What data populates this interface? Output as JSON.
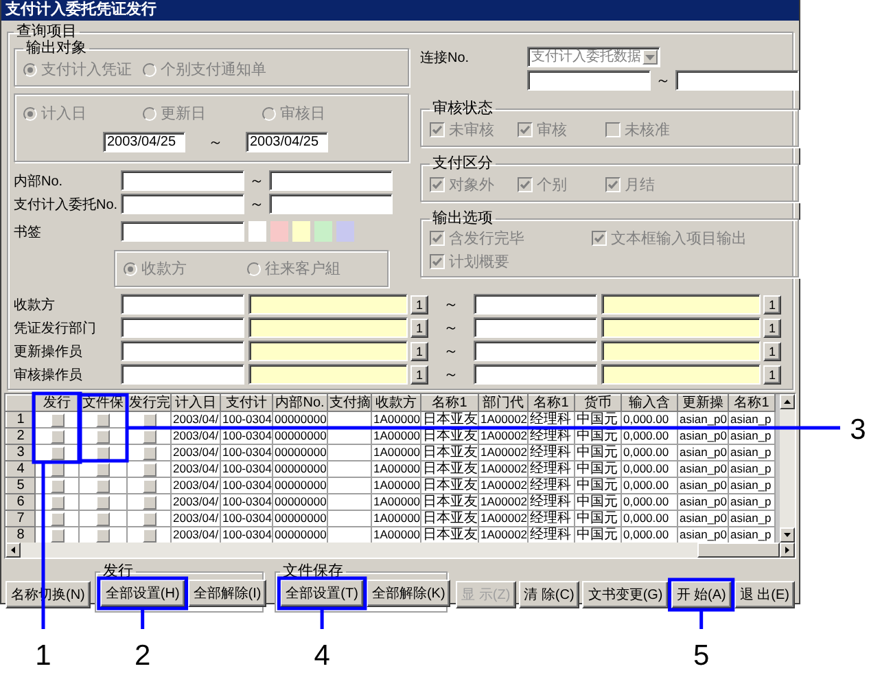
{
  "window": {
    "title": "支付计入委托凭证发行"
  },
  "query": {
    "title": "查询项目",
    "output_target": {
      "title": "输出对象",
      "options": [
        {
          "label": "支付计入凭证",
          "selected": true,
          "disabled": true
        },
        {
          "label": "个别支付通知单",
          "selected": false,
          "disabled": true
        }
      ]
    },
    "date_type": {
      "options": [
        {
          "label": "计入日",
          "selected": true,
          "disabled": true
        },
        {
          "label": "更新日",
          "selected": false,
          "disabled": true
        },
        {
          "label": "审核日",
          "selected": false,
          "disabled": true
        }
      ],
      "from": "2003/04/25",
      "separator": "～",
      "to": "2003/04/25"
    },
    "ranges": [
      {
        "label": "内部No.",
        "separator": "～"
      },
      {
        "label": "支付计入委托No.",
        "separator": "～"
      }
    ],
    "bookmark": {
      "label": "书签",
      "colors": [
        {
          "color": "#ffffff"
        },
        {
          "color": "#f8c8c8"
        },
        {
          "color": "#ffffc8"
        },
        {
          "color": "#c8f0c8"
        },
        {
          "color": "#c8c8f0"
        }
      ]
    },
    "payee_type": {
      "options": [
        {
          "label": "收款方",
          "selected": true,
          "disabled": true
        },
        {
          "label": "往来客户組",
          "selected": false,
          "disabled": true
        }
      ]
    },
    "link": {
      "label": "连接No.",
      "combo": {
        "value": "支付计入委托数据",
        "disabled": true
      },
      "separator": "～"
    },
    "review_status": {
      "title": "审核状态",
      "options": [
        {
          "label": "未审核",
          "checked": true,
          "disabled": true
        },
        {
          "label": "审核",
          "checked": true,
          "disabled": true
        },
        {
          "label": "未核准",
          "checked": false,
          "disabled": true
        }
      ]
    },
    "payment_class": {
      "title": "支付区分",
      "options": [
        {
          "label": "对象外",
          "checked": true,
          "disabled": true
        },
        {
          "label": "个别",
          "checked": true,
          "disabled": true
        },
        {
          "label": "月结",
          "checked": true,
          "disabled": true
        }
      ]
    },
    "output_options": {
      "title": "输出选项",
      "options": [
        {
          "label": "含发行完毕",
          "checked": true,
          "disabled": true
        },
        {
          "label": "文本框输入项目输出",
          "checked": true,
          "disabled": true
        },
        {
          "label": "计划概要",
          "checked": true,
          "disabled": true
        }
      ]
    },
    "lookups": [
      {
        "label": "收款方",
        "buttons": [
          "1",
          "1"
        ],
        "separator": "～"
      },
      {
        "label": "凭证发行部门",
        "buttons": [
          "1",
          "1"
        ],
        "separator": "～"
      },
      {
        "label": "更新操作员",
        "buttons": [
          "1",
          "1"
        ],
        "separator": "～"
      },
      {
        "label": "审核操作员",
        "buttons": [
          "1",
          "1"
        ],
        "separator": "～"
      }
    ]
  },
  "grid": {
    "columns": [
      "发行",
      "文件保",
      "发行完",
      "计入日",
      "支付计",
      "内部No.",
      "支付摘",
      "收款方",
      "名称1",
      "部门代",
      "名称1",
      "货币",
      "输入含",
      "更新操",
      "名称1"
    ],
    "rows": [
      {
        "number": "1",
        "cells": [
          {
            "kind": "checkbox",
            "checked": false
          },
          {
            "kind": "checkbox",
            "checked": false
          },
          {
            "kind": "checkbox",
            "checked": false
          },
          "2003/04/",
          "100-0304",
          "00000000",
          "",
          "1A00000",
          "日本亚友",
          "1A00002",
          "经理科",
          "中国元",
          "0,000.00",
          "asian_p0",
          "asian_p"
        ]
      },
      {
        "number": "2",
        "cells": [
          {
            "kind": "checkbox",
            "checked": false
          },
          {
            "kind": "checkbox",
            "checked": false
          },
          {
            "kind": "checkbox",
            "checked": false
          },
          "2003/04/",
          "100-0304",
          "00000000",
          "",
          "1A00000",
          "日本亚友",
          "1A00002",
          "经理科",
          "中国元",
          "0,000.00",
          "asian_p0",
          "asian_p"
        ]
      },
      {
        "number": "3",
        "cells": [
          {
            "kind": "checkbox",
            "checked": false
          },
          {
            "kind": "checkbox",
            "checked": false
          },
          {
            "kind": "checkbox",
            "checked": false
          },
          "2003/04/",
          "100-0304",
          "00000000",
          "",
          "1A00000",
          "日本亚友",
          "1A00002",
          "经理科",
          "中国元",
          "0,000.00",
          "asian_p0",
          "asian_p"
        ]
      },
      {
        "number": "4",
        "cells": [
          {
            "kind": "checkbox",
            "checked": false
          },
          {
            "kind": "checkbox",
            "checked": false
          },
          {
            "kind": "checkbox",
            "checked": false
          },
          "2003/04/",
          "100-0304",
          "00000000",
          "",
          "1A00000",
          "日本亚友",
          "1A00002",
          "经理科",
          "中国元",
          "0,000.00",
          "asian_p0",
          "asian_p"
        ]
      },
      {
        "number": "5",
        "cells": [
          {
            "kind": "checkbox",
            "checked": false
          },
          {
            "kind": "checkbox",
            "checked": false
          },
          {
            "kind": "checkbox",
            "checked": false
          },
          "2003/04/",
          "100-0304",
          "00000000",
          "",
          "1A00000",
          "日本亚友",
          "1A00002",
          "经理科",
          "中国元",
          "0,000.00",
          "asian_p0",
          "asian_p"
        ]
      },
      {
        "number": "6",
        "cells": [
          {
            "kind": "checkbox",
            "checked": false
          },
          {
            "kind": "checkbox",
            "checked": false
          },
          {
            "kind": "checkbox",
            "checked": false
          },
          "2003/04/",
          "100-0304",
          "00000000",
          "",
          "1A00000",
          "日本亚友",
          "1A00002",
          "经理科",
          "中国元",
          "0,000.00",
          "asian_p0",
          "asian_p"
        ]
      },
      {
        "number": "7",
        "cells": [
          {
            "kind": "checkbox",
            "checked": false
          },
          {
            "kind": "checkbox",
            "checked": false
          },
          {
            "kind": "checkbox",
            "checked": false
          },
          "2003/04/",
          "100-0304",
          "00000000",
          "",
          "1A00000",
          "日本亚友",
          "1A00002",
          "经理科",
          "中国元",
          "0,000.00",
          "asian_p0",
          "asian_p"
        ]
      },
      {
        "number": "8",
        "cells": [
          {
            "kind": "checkbox",
            "checked": false
          },
          {
            "kind": "checkbox",
            "checked": false
          },
          {
            "kind": "checkbox",
            "checked": false
          },
          "2003/04/",
          "100-0304",
          "00000000",
          "",
          "1A00000",
          "日本亚友",
          "1A00002",
          "经理科",
          "中国元",
          "0,000.00",
          "asian_p0",
          "asian_p"
        ]
      }
    ]
  },
  "footer": {
    "toggle_button": {
      "label": "名称切换(N)"
    },
    "issue_group": {
      "title": "发行",
      "buttons": [
        {
          "label": "全部设置(H)"
        },
        {
          "label": "全部解除(I)"
        }
      ]
    },
    "save_group": {
      "title": "文件保存",
      "buttons": [
        {
          "label": "全部设置(T)"
        },
        {
          "label": "全部解除(K)"
        }
      ]
    },
    "buttons": [
      {
        "label": "显 示(Z)",
        "disabled": true
      },
      {
        "label": "清 除(C)",
        "disabled": false
      },
      {
        "label": "文书变更(G)",
        "disabled": false
      },
      {
        "label": "开 始(A)",
        "disabled": false
      },
      {
        "label": "退 出(E)",
        "disabled": false
      }
    ]
  },
  "callouts": [
    {
      "label": "1"
    },
    {
      "label": "2"
    },
    {
      "label": "3"
    },
    {
      "label": "4"
    },
    {
      "label": "5"
    }
  ]
}
